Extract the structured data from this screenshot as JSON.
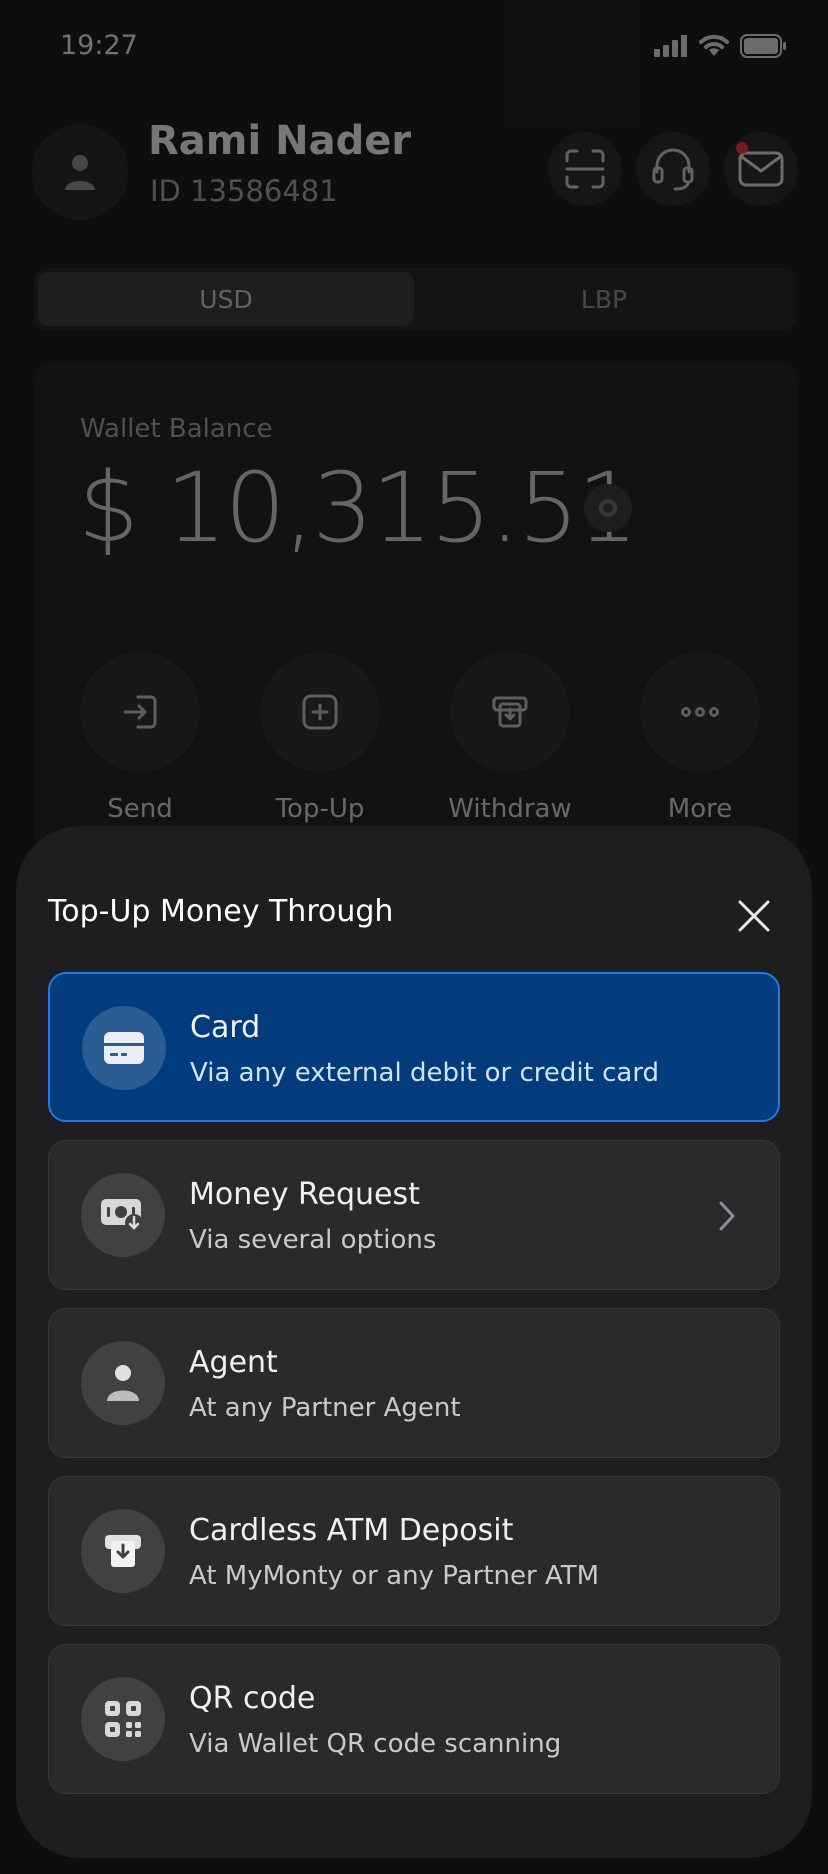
{
  "status": {
    "time": "19:27"
  },
  "user": {
    "name": "Rami Nader",
    "id": "ID 13586481"
  },
  "header_icons": [
    "scan-icon",
    "headset-icon",
    "mail-icon"
  ],
  "currency": {
    "options": [
      "USD",
      "LBP"
    ],
    "selected": "USD"
  },
  "wallet": {
    "label": "Wallet Balance",
    "amount": "$ 10,315.51",
    "actions": [
      {
        "label": "Send",
        "icon": "send-icon"
      },
      {
        "label": "Top-Up",
        "icon": "plus-square-icon"
      },
      {
        "label": "Withdraw",
        "icon": "withdraw-icon"
      },
      {
        "label": "More",
        "icon": "more-icon"
      }
    ]
  },
  "sheet": {
    "title": "Top-Up Money Through",
    "options": [
      {
        "title": "Card",
        "subtitle": "Via any external debit or credit card",
        "icon": "card-icon",
        "selected": true
      },
      {
        "title": "Money Request",
        "subtitle": "Via several options",
        "icon": "money-request-icon",
        "chevron": true
      },
      {
        "title": "Agent",
        "subtitle": "At any Partner Agent",
        "icon": "person-icon"
      },
      {
        "title": "Cardless ATM Deposit",
        "subtitle": "At MyMonty or any Partner ATM",
        "icon": "atm-icon"
      },
      {
        "title": "QR code",
        "subtitle": "Via Wallet QR code scanning",
        "icon": "qr-code-icon"
      }
    ]
  },
  "colors": {
    "selected_bg": "#033c7c",
    "selected_border": "#1f7ae8",
    "notification_dot": "#e23b3b"
  }
}
